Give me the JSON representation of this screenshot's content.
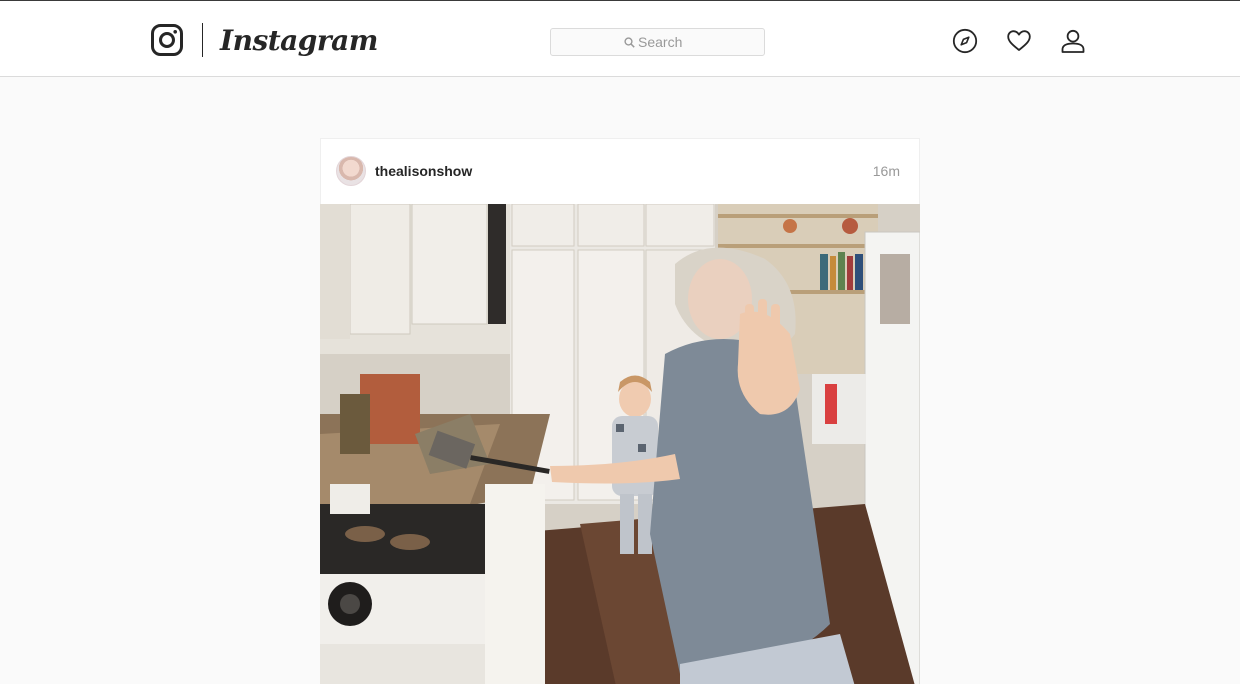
{
  "nav": {
    "brand_name": "Instagram",
    "search": {
      "placeholder": "Search",
      "value": ""
    },
    "icons": [
      "explore-compass-icon",
      "activity-heart-icon",
      "profile-person-icon"
    ]
  },
  "post": {
    "username": "thealisonshow",
    "timestamp": "16m",
    "media_description": "kitchen video frame"
  },
  "colors": {
    "page_background": "#fafafa",
    "header_background": "#ffffff",
    "border": "#dbdbdb",
    "text_primary": "#262626",
    "text_secondary": "#999999"
  }
}
